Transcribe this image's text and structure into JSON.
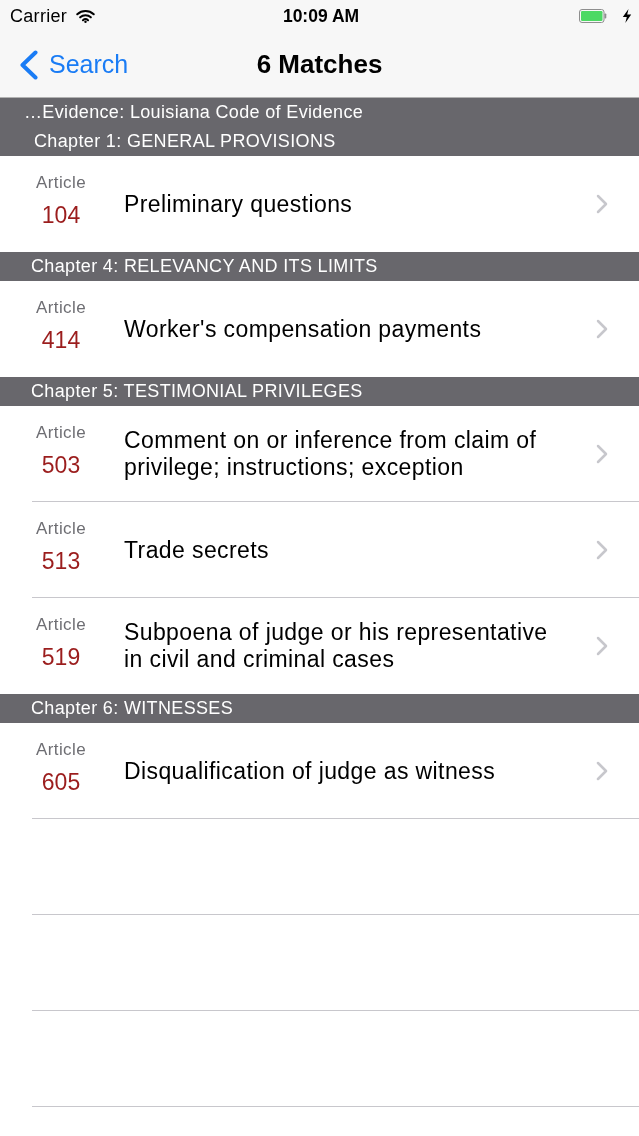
{
  "status_bar": {
    "carrier": "Carrier",
    "time": "10:09 AM"
  },
  "nav_bar": {
    "back_button": "Search",
    "title": "6 Matches"
  },
  "results": {
    "breadcrumb": "…Evidence: Louisiana Code of Evidence",
    "sections": [
      {
        "header": "Chapter 1: GENERAL PROVISIONS",
        "rows": [
          {
            "label": "Article",
            "number": "104",
            "title": "Preliminary questions"
          }
        ]
      },
      {
        "header": "Chapter 4: RELEVANCY AND ITS LIMITS",
        "rows": [
          {
            "label": "Article",
            "number": "414",
            "title": "Worker's compensation payments"
          }
        ]
      },
      {
        "header": "Chapter 5: TESTIMONIAL PRIVILEGES",
        "rows": [
          {
            "label": "Article",
            "number": "503",
            "title": "Comment on or inference from claim of privilege; instructions; exception"
          },
          {
            "label": "Article",
            "number": "513",
            "title": "Trade secrets"
          },
          {
            "label": "Article",
            "number": "519",
            "title": "Subpoena of judge or his representative in civil and criminal cases"
          }
        ]
      },
      {
        "header": "Chapter 6: WITNESSES",
        "rows": [
          {
            "label": "Article",
            "number": "605",
            "title": "Disqualification of judge as witness"
          }
        ]
      }
    ]
  }
}
